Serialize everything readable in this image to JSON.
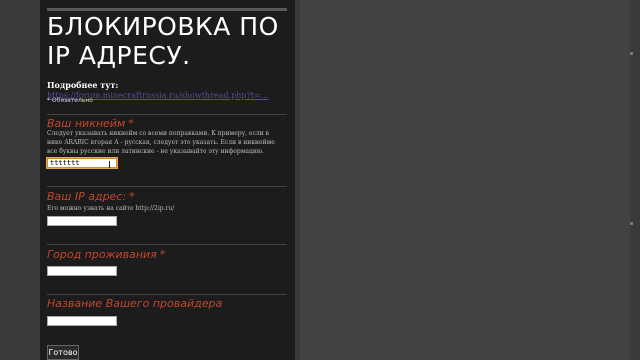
{
  "form": {
    "title": "БЛОКИРОВКА ПО IP АДРЕСУ.",
    "more_label": "Подробнее тут:",
    "more_link": "https://forum.minecraftrussia.ru/showthread.php?t=...",
    "required_note": "* Обязательно",
    "submit_label": "Готово"
  },
  "questions": [
    {
      "label": "Ваш никнейм",
      "required": true,
      "help": "Следует указывать никнейм со всеми поправками. К примеру, если в нике ARABIC вторая А - русская, следует это указать. Если в никнейме все буквы русские или латинские - не указывайте эту информацию.",
      "value": "ttttttt"
    },
    {
      "label": "Ваш IP адрес:",
      "required": true,
      "help": "Его можно узнать на сайте http://2ip.ru/",
      "value": ""
    },
    {
      "label": "Город проживания",
      "required": true,
      "help": "",
      "value": ""
    },
    {
      "label": "Название Вашего провайдера",
      "required": false,
      "help": "",
      "value": ""
    }
  ],
  "colors": {
    "panel_bg": "#1c1c1c",
    "label_red": "#c2462a",
    "page_bg": "#3a3a3a",
    "link": "#5a4aa0"
  }
}
